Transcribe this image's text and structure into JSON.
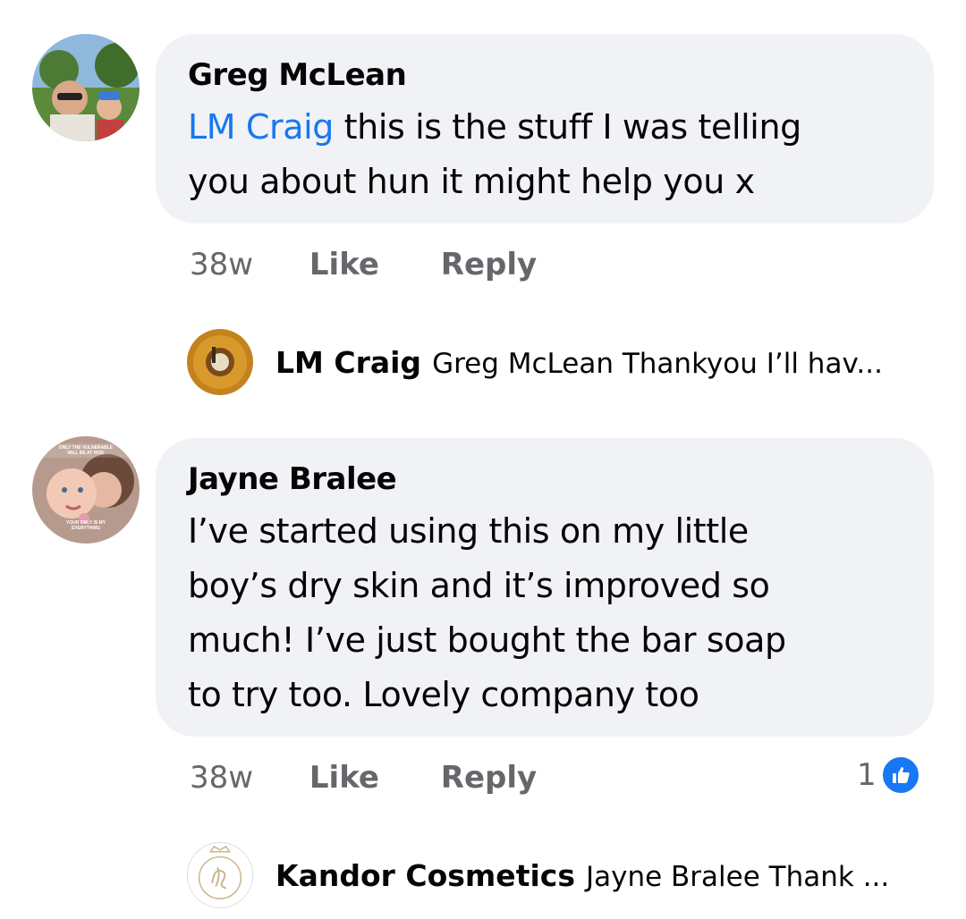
{
  "comments": [
    {
      "author": "Greg McLean",
      "mention": "LM Craig",
      "text_line1": " this is the stuff I was telling",
      "text_line2": "you about hun it might help you x",
      "time": "38w",
      "like_label": "Like",
      "reply_label": "Reply",
      "reply": {
        "author": "LM Craig",
        "text": "Greg McLean Thankyou I’ll hav..."
      }
    },
    {
      "author": "Jayne Bralee",
      "text_lines": [
        "I’ve started using this on my little",
        "boy’s dry skin and it’s improved so",
        "much! I’ve just bought the bar soap",
        "to try too. Lovely company too"
      ],
      "time": "38w",
      "like_label": "Like",
      "reply_label": "Reply",
      "reaction_count": "1",
      "reaction_icon": "thumbs-up-icon",
      "reply": {
        "author": "Kandor Cosmetics",
        "text": "Jayne Bralee Thank ..."
      },
      "avatar_overlay_text": [
        "ONLY THE VULNERABLE",
        "WILL BE AT RISK",
        "YOUR ONLY IS MY",
        "EVERYTHING"
      ]
    }
  ],
  "colors": {
    "bubble": "#f0f2f5",
    "mention": "#1877f2",
    "meta": "#65676b",
    "text": "#050505",
    "like_badge": "#1877f2"
  }
}
